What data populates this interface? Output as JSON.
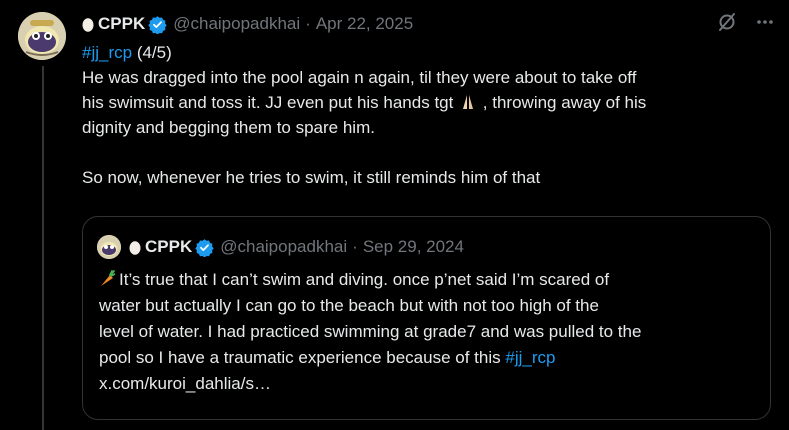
{
  "tweet": {
    "name": "CPPK",
    "handle": "@chaipopadkhai",
    "separator": "·",
    "date": "Apr 22, 2025",
    "hashtag": "#jj_rcp",
    "counter": " (4/5)",
    "line1": "He was dragged into the pool again n again, til they were about to take off",
    "line2a": "his swimsuit and toss it. JJ even put his hands tgt",
    "line2b": " , throwing away of his",
    "line3": "dignity and begging them to spare him.",
    "line4": "So now, whenever he tries to swim, it still reminds him of that",
    "icons": {
      "egg": "egg-emoji-icon",
      "verified": "verified-badge-icon",
      "grok": "grok-icon",
      "more": "more-options-icon",
      "pray": "praying-hands-emoji-icon"
    }
  },
  "quoted": {
    "name": "CPPK",
    "handle": "@chaipopadkhai",
    "separator": "·",
    "date": "Sep 29, 2024",
    "line1": "It’s true that I can’t swim and diving. once p’net said I’m scared of",
    "line2": "water but actually I can go to the beach but with not too high of the",
    "line3": "level of water. I had practiced swimming at grade7 and was pulled to the",
    "line4a": "pool so I have a traumatic experience because of this ",
    "line4_hashtag": "#jj_rcp",
    "line5": "x.com/kuroi_dahlia/s…",
    "icons": {
      "carrot": "carrot-emoji-icon"
    }
  },
  "colors": {
    "background": "#000000",
    "text": "#e7e9ea",
    "muted": "#71767b",
    "accent": "#1d9bf0",
    "border": "#2f3336"
  }
}
